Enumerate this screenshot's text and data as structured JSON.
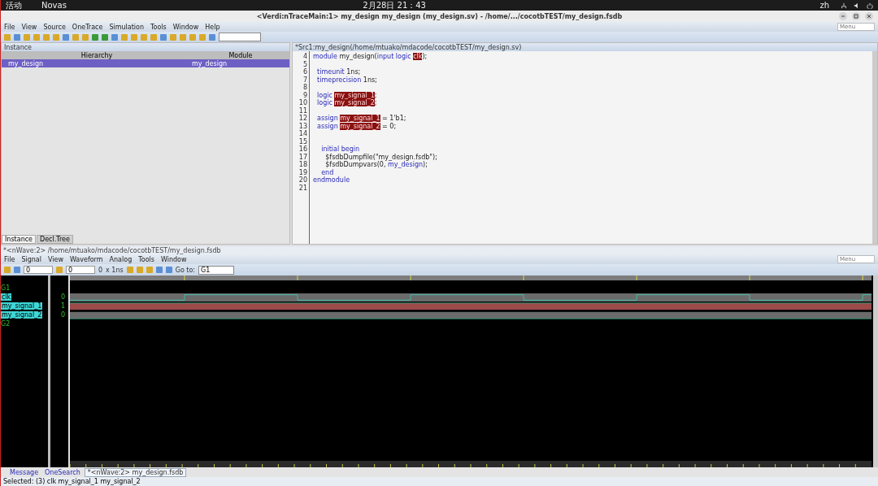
{
  "system_bar": {
    "activities": "活动",
    "app": "Novas",
    "clock": "2月28日 21：43",
    "input_method": "zh"
  },
  "window": {
    "title": "<Verdi:nTraceMain:1> my_design my_design (my_design.sv) - /home/.../cocotbTEST/my_design.fsdb",
    "menu": [
      "File",
      "View",
      "Source",
      "OneTrace",
      "Simulation",
      "Tools",
      "Window",
      "Help"
    ],
    "menu_search": {
      "placeholder": "Menu"
    }
  },
  "instance_panel": {
    "title": "Instance",
    "columns": [
      "Hierarchy",
      "Module"
    ],
    "rows": [
      {
        "hierarchy": "my_design",
        "module": "my_design",
        "selected": true
      }
    ],
    "tabs": [
      {
        "label": "Instance",
        "selected": true
      },
      {
        "label": "Decl.Tree",
        "selected": false
      }
    ]
  },
  "source_panel": {
    "title": "*Src1:my_design(/home/mtuako/mdacode/cocotbTEST/my_design.sv)",
    "lines": [
      {
        "number": "4",
        "segments": [
          {
            "kind": "keyword",
            "text": "module"
          },
          {
            "kind": "plain",
            "text": " my_design("
          },
          {
            "kind": "keyword",
            "text": "input logic "
          },
          {
            "kind": "highlight",
            "text": "clk"
          },
          {
            "kind": "plain",
            "text": ");"
          }
        ]
      },
      {
        "number": "5"
      },
      {
        "number": "6",
        "segments": [
          {
            "kind": "keyword",
            "text": "  timeunit"
          },
          {
            "kind": "plain",
            "text": " 1ns;"
          }
        ]
      },
      {
        "number": "7",
        "segments": [
          {
            "kind": "keyword",
            "text": "  timeprecision"
          },
          {
            "kind": "plain",
            "text": " 1ns;"
          }
        ]
      },
      {
        "number": "8"
      },
      {
        "number": "9",
        "segments": [
          {
            "kind": "keyword",
            "text": "  logic "
          },
          {
            "kind": "highlight",
            "text": "my_signal_1"
          },
          {
            "kind": "plain",
            "text": ";"
          }
        ]
      },
      {
        "number": "10",
        "segments": [
          {
            "kind": "keyword",
            "text": "  logic "
          },
          {
            "kind": "highlight",
            "text": "my_signal_2"
          },
          {
            "kind": "plain",
            "text": ";"
          }
        ]
      },
      {
        "number": "11"
      },
      {
        "number": "12",
        "segments": [
          {
            "kind": "keyword",
            "text": "  assign "
          },
          {
            "kind": "highlight",
            "text": "my_signal_1"
          },
          {
            "kind": "plain",
            "text": " = 1'b1;"
          }
        ]
      },
      {
        "number": "13",
        "segments": [
          {
            "kind": "keyword",
            "text": "  assign "
          },
          {
            "kind": "highlight",
            "text": "my_signal_2"
          },
          {
            "kind": "plain",
            "text": " = 0;"
          }
        ]
      },
      {
        "number": "14"
      },
      {
        "number": "15"
      },
      {
        "number": "16",
        "segments": [
          {
            "kind": "keyword",
            "text": "    initial begin"
          }
        ]
      },
      {
        "number": "17",
        "segments": [
          {
            "kind": "plain",
            "text": "      $fsdbDumpfile(\"my_design.fsdb\");"
          }
        ]
      },
      {
        "number": "18",
        "segments": [
          {
            "kind": "plain",
            "text": "      $fsdbDumpvars(0, "
          },
          {
            "kind": "keyword",
            "text": "my_design"
          },
          {
            "kind": "plain",
            "text": ");"
          }
        ]
      },
      {
        "number": "19",
        "segments": [
          {
            "kind": "keyword",
            "text": "    end"
          }
        ]
      },
      {
        "number": "20",
        "segments": [
          {
            "kind": "keyword",
            "text": "endmodule"
          }
        ]
      },
      {
        "number": "21"
      }
    ]
  },
  "wave_window": {
    "title": "*<nWave:2> /home/mtuako/mdacode/cocotbTEST/my_design.fsdb",
    "menu": [
      "File",
      "Signal",
      "View",
      "Waveform",
      "Analog",
      "Tools",
      "Window"
    ],
    "menu_search": {
      "placeholder": "Menu"
    },
    "toolbar": {
      "cursor_time": "0",
      "marker_time": "0",
      "delta": "0",
      "scale": "x 1ns",
      "goto_label": "Go to:",
      "goto_value": "G1"
    },
    "signals": [
      {
        "kind": "group",
        "name": "G1"
      },
      {
        "kind": "clock",
        "name": "clk",
        "value": "0",
        "selected": true
      },
      {
        "kind": "high",
        "name": "my_signal_1",
        "value": "1",
        "selected": true
      },
      {
        "kind": "low",
        "name": "my_signal_2",
        "value": "0",
        "selected": true
      },
      {
        "kind": "group",
        "name": "G2"
      }
    ],
    "tabs": [
      {
        "label": "Message",
        "selected": false
      },
      {
        "label": "OneSearch",
        "selected": false
      },
      {
        "label": "*<nWave:2> my_design.fsdb",
        "selected": true
      }
    ],
    "status": "Selected: (3) clk my_signal_1 my_signal_2"
  }
}
